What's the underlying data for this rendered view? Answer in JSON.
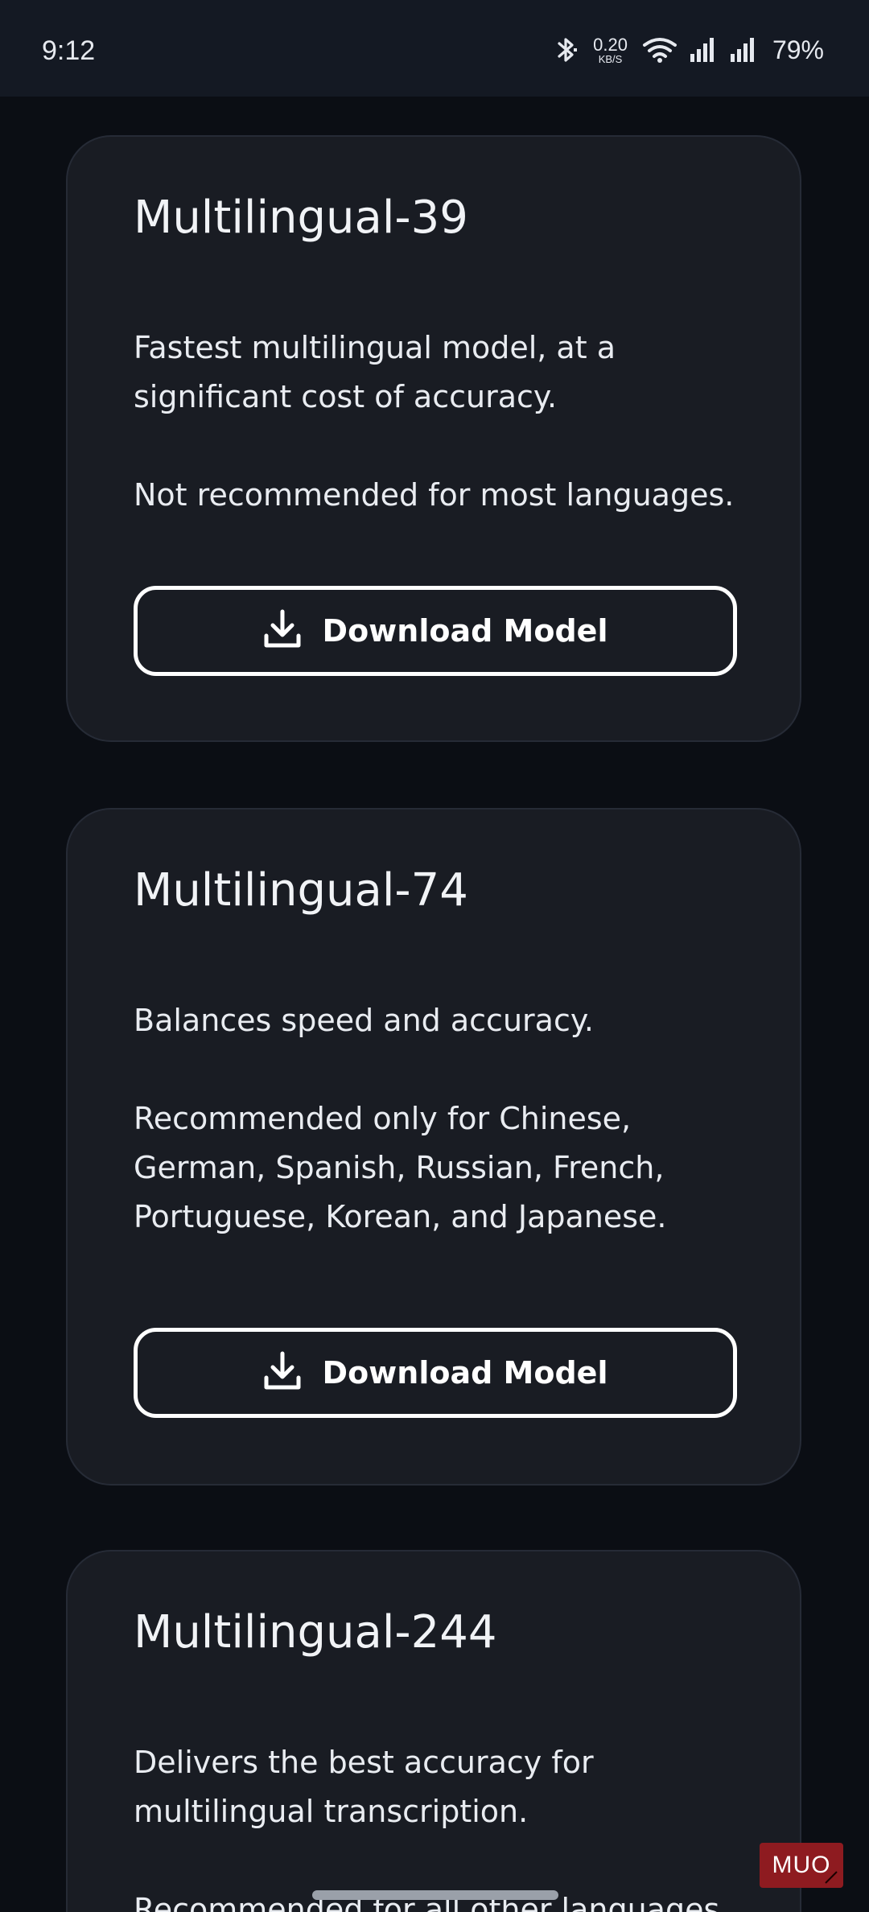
{
  "status_bar": {
    "time": "9:12",
    "net_speed_value": "0.20",
    "net_speed_unit": "KB/S",
    "battery": "79%",
    "icons": [
      "bluetooth-icon",
      "wifi-icon",
      "signal-icon",
      "signal-icon"
    ]
  },
  "cards": [
    {
      "title": "Multilingual-39",
      "desc": [
        "Fastest multilingual model, at a significant cost of accuracy.",
        "Not recommended for most languages."
      ],
      "button": "Download Model"
    },
    {
      "title": "Multilingual-74",
      "desc": [
        "Balances speed and accuracy.",
        "Recommended only for Chinese, German, Spanish, Russian, French, Portuguese, Korean, and Japanese."
      ],
      "button": "Download Model"
    },
    {
      "title": "Multilingual-244",
      "desc": [
        "Delivers the best accuracy for multilingual transcription.",
        "Recommended for all other languages."
      ]
    }
  ],
  "watermark": "MUO",
  "colors": {
    "background": "#0b0e14",
    "card": "#191c23",
    "card_border": "#262b36",
    "button_border": "#ffffff",
    "watermark": "#8e1b20"
  }
}
